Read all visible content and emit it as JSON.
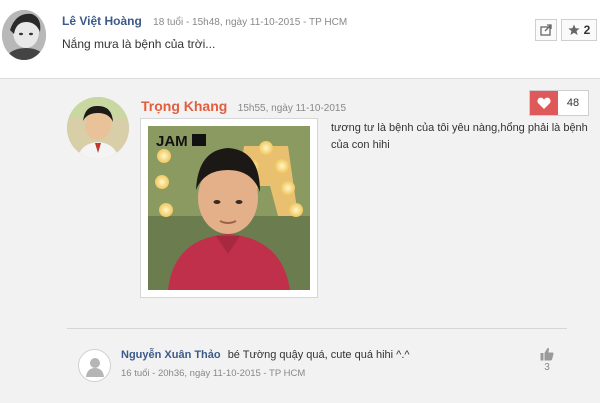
{
  "top_post": {
    "author": "Lê Việt Hoàng",
    "meta": "18 tuổi - 15h48, ngày 11-10-2015 - TP HCM",
    "text": "Nắng mưa là bệnh của trời...",
    "star_count": "2"
  },
  "reply": {
    "author": "Trọng Khang",
    "meta": "15h55, ngày 11-10-2015",
    "like_count": "48",
    "text": "tương tư là bệnh của tôi yêu nàng,hổng phải là bệnh của con hihi",
    "photo_logo": "JAM"
  },
  "sub_reply": {
    "author": "Nguyễn Xuân Thảo",
    "text": "bé Tường quậy quá, cute quá hihi ^.^",
    "meta": "16 tuổi - 20h36, ngày 11-10-2015 - TP HCM",
    "like_count": "3"
  },
  "colors": {
    "author_blue": "#3b5a8a",
    "reply_orange": "#e35d3f",
    "like_red": "#e0595a",
    "panel_gray": "#f2f2f2"
  },
  "icons": [
    "share-icon",
    "star-icon",
    "heart-icon",
    "thumbs-up-icon",
    "default-user-icon"
  ]
}
